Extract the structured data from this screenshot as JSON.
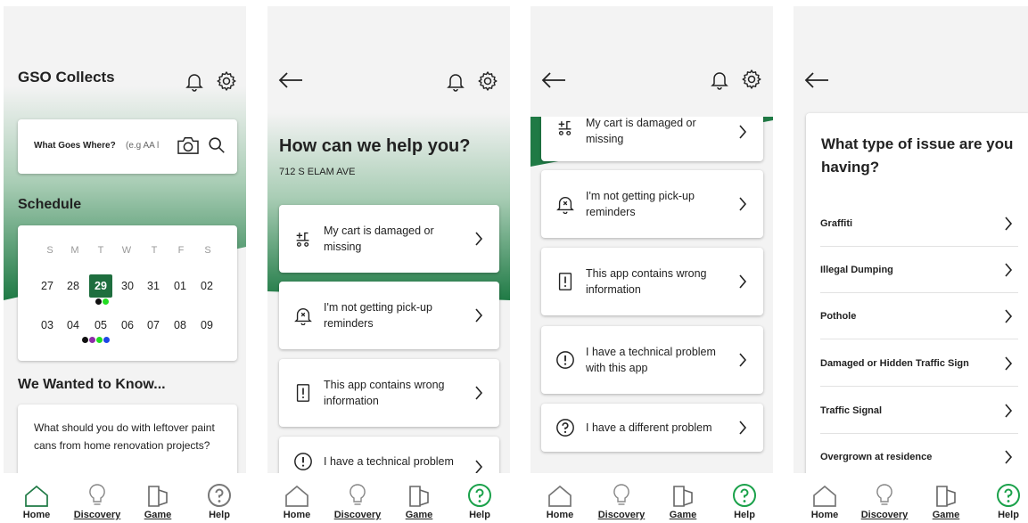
{
  "screen1": {
    "app_title": "GSO Collects",
    "search": {
      "label": "What Goes Where?",
      "placeholder": "(e.g AA l"
    },
    "schedule": {
      "title": "Schedule",
      "weekdays": [
        "S",
        "M",
        "T",
        "W",
        "T",
        "F",
        "S"
      ],
      "week1": [
        "27",
        "28",
        "29",
        "30",
        "31",
        "01",
        "02"
      ],
      "week2": [
        "03",
        "04",
        "05",
        "06",
        "07",
        "08",
        "09"
      ],
      "selected_day": "29",
      "dot_colors": {
        "black": "#111111",
        "green": "#22dd22",
        "purple": "#8e2ca8",
        "blue": "#1e46e6"
      }
    },
    "know": {
      "title": "We Wanted to Know...",
      "question": "What should you do with leftover paint cans from home renovation projects?"
    }
  },
  "screen2": {
    "title": "How can we help you?",
    "address": "712 S ELAM AVE",
    "items": [
      {
        "label": "My cart is damaged or missing",
        "icon": "cart-icon"
      },
      {
        "label": "I'm not getting pick-up reminders",
        "icon": "bell-x-icon"
      },
      {
        "label": "This app contains wrong information",
        "icon": "phone-alert-icon"
      },
      {
        "label": "I have a technical problem",
        "icon": "alert-circle-icon"
      }
    ]
  },
  "screen3": {
    "items": [
      {
        "label": "My cart is damaged or missing",
        "icon": "cart-icon"
      },
      {
        "label": "I'm not getting pick-up reminders",
        "icon": "bell-x-icon"
      },
      {
        "label": "This app contains wrong information",
        "icon": "phone-alert-icon"
      },
      {
        "label": "I have a technical problem with this app",
        "icon": "alert-circle-icon"
      },
      {
        "label": "I have a different problem",
        "icon": "question-circle-icon"
      }
    ]
  },
  "screen4": {
    "title": "What type of issue are you having?",
    "issues": [
      "Graffiti",
      "Illegal Dumping",
      "Pothole",
      "Damaged or Hidden Traffic Sign",
      "Traffic Signal",
      "Overgrown at residence"
    ]
  },
  "nav": {
    "home": "Home",
    "discovery": "Discovery",
    "game": "Game",
    "help": "Help"
  },
  "colors": {
    "brand_green": "#1f7a45",
    "selected_day_bg": "#1e6e3e",
    "help_active": "#1aa14a"
  }
}
